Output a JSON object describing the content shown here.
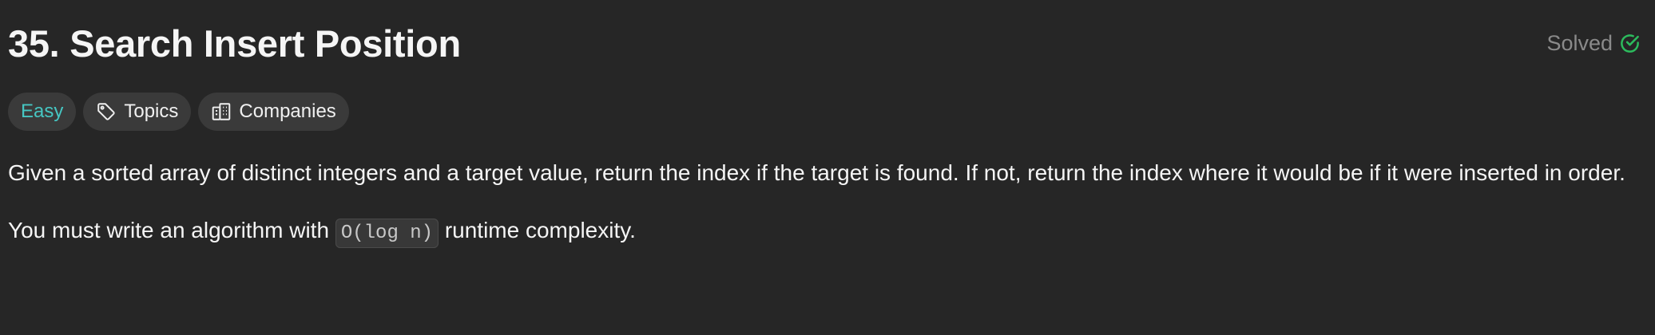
{
  "problem": {
    "title": "35. Search Insert Position",
    "status": "Solved"
  },
  "tags": {
    "difficulty": "Easy",
    "topics": "Topics",
    "companies": "Companies"
  },
  "description": {
    "paragraph1": "Given a sorted array of distinct integers and a target value, return the index if the target is found. If not, return the index where it would be if it were inserted in order.",
    "paragraph2_before": "You must write an algorithm with",
    "paragraph2_code": "O(log n)",
    "paragraph2_after": "runtime complexity."
  },
  "colors": {
    "background": "#262626",
    "easy": "#46c6c2",
    "solved_check": "#2cbb5d",
    "muted": "#8a8a8a"
  },
  "icons": {
    "solved": "check-circle-icon",
    "topics": "tag-icon",
    "companies": "building-icon"
  }
}
